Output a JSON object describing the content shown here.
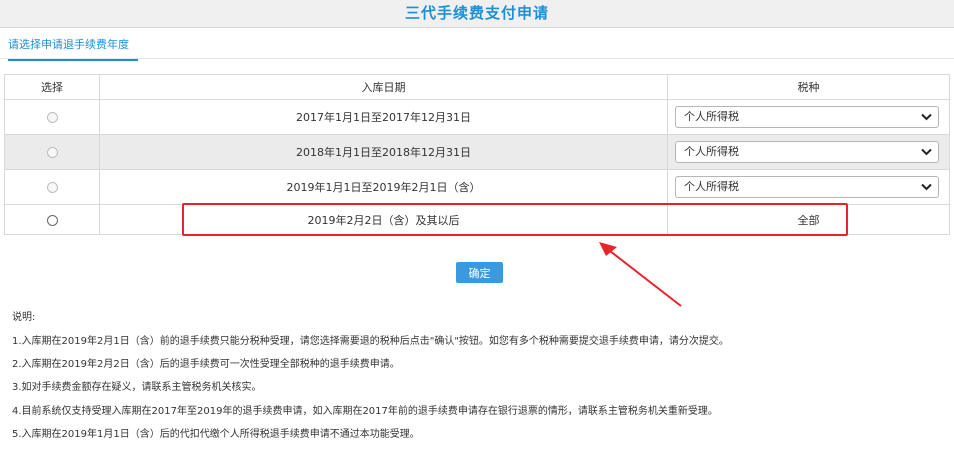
{
  "title": "三代手续费支付申请",
  "tab": {
    "label": "请选择申请退手续费年度"
  },
  "table": {
    "headers": [
      "选择",
      "入库日期",
      "税种"
    ],
    "rows": [
      {
        "date": "2017年1月1日至2017年12月31日",
        "tax": "个人所得税"
      },
      {
        "date": "2018年1月1日至2018年12月31日",
        "tax": "个人所得税"
      },
      {
        "date": "2019年1月1日至2019年2月1日（含）",
        "tax": "个人所得税"
      },
      {
        "date": "2019年2月2日（含）及其以后",
        "tax": "全部"
      }
    ]
  },
  "confirm_label": "确定",
  "notes": {
    "heading": "说明:",
    "items": [
      "1.入库期在2019年2月1日（含）前的退手续费只能分税种受理，请您选择需要退的税种后点击\"确认\"按钮。如您有多个税种需要提交退手续费申请，请分次提交。",
      "2.入库期在2019年2月2日（含）后的退手续费可一次性受理全部税种的退手续费申请。",
      "3.如对手续费金额存在疑义，请联系主管税务机关核实。",
      "4.目前系统仅支持受理入库期在2017年至2019年的退手续费申请，如入库期在2017年前的退手续费申请存在银行退票的情形，请联系主管税务机关重新受理。",
      "5.入库期在2019年1月1日（含）后的代扣代缴个人所得税退手续费申请不通过本功能受理。"
    ]
  },
  "colors": {
    "accent": "#1e8fd6",
    "button": "#3b99e0",
    "annotation": "#e8242a"
  }
}
